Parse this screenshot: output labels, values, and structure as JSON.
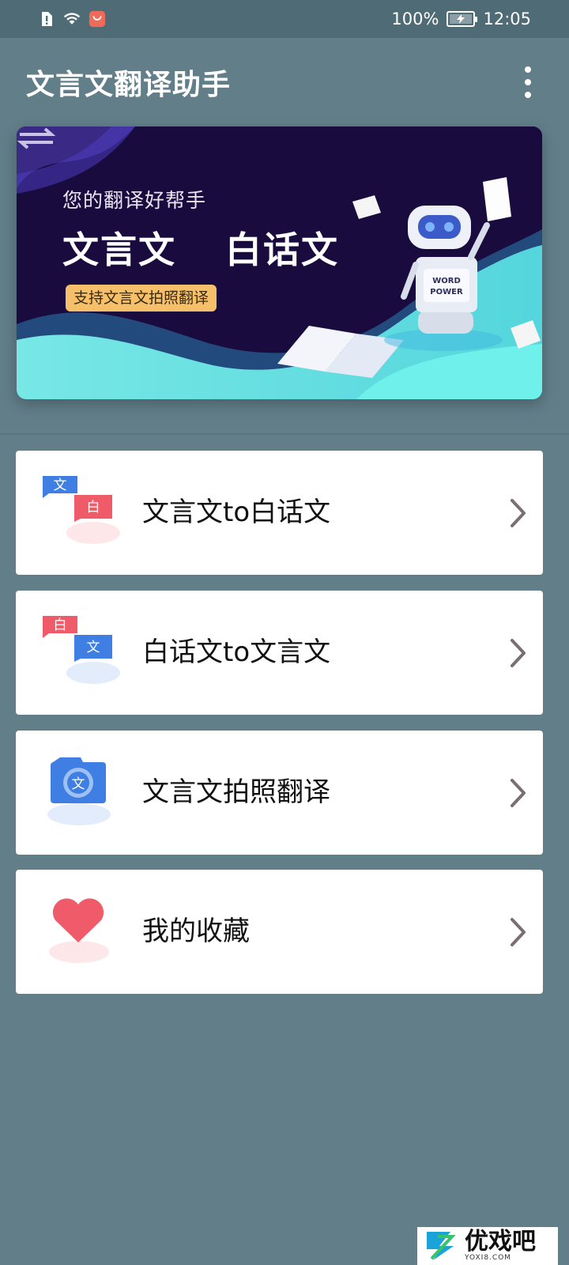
{
  "status_bar": {
    "battery_percent": "100%",
    "time": "12:05",
    "icons": [
      "sim-alert-icon",
      "wifi-icon",
      "app-notification-icon",
      "battery-charging-icon"
    ]
  },
  "app_bar": {
    "title": "文言文翻译助手",
    "menu_icon": "more-vert-icon"
  },
  "banner": {
    "subtitle": "您的翻译好帮手",
    "left_word": "文言文",
    "right_word": "白话文",
    "tag": "支持文言文拍照翻译",
    "robot_text": "WORD POWER"
  },
  "menu": [
    {
      "label": "文言文to白话文",
      "icon": "classical-to-vernacular-icon",
      "icon_top_char": "文",
      "icon_bottom_char": "白"
    },
    {
      "label": "白话文to文言文",
      "icon": "vernacular-to-classical-icon",
      "icon_top_char": "白",
      "icon_bottom_char": "文"
    },
    {
      "label": "文言文拍照翻译",
      "icon": "camera-icon",
      "icon_char": "文"
    },
    {
      "label": "我的收藏",
      "icon": "heart-icon"
    }
  ],
  "watermark": {
    "text": "优戏吧",
    "sub": "YOXI8.COM"
  },
  "colors": {
    "background": "#627e89",
    "status_bar": "#4e6b76",
    "blue": "#3f7fe3",
    "red": "#f05b6a",
    "banner_bg": "#1a0b3f",
    "banner_teal": "#5fe0e0",
    "tag": "#f6c06a"
  }
}
